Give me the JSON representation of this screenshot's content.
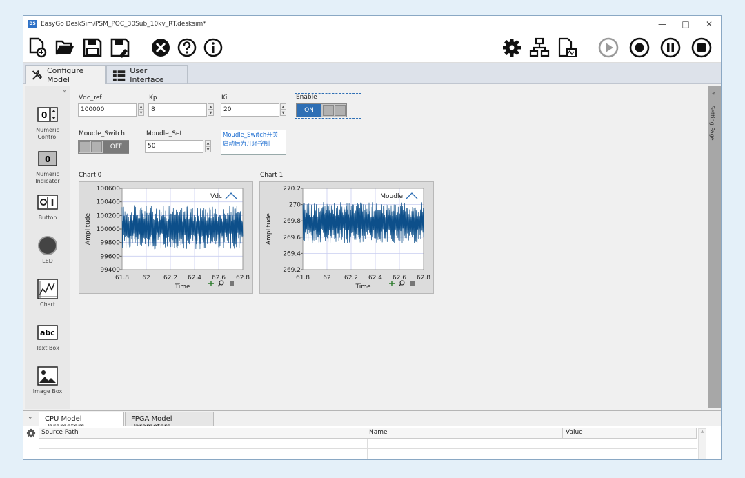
{
  "window": {
    "title": "EasyGo DeskSim/PSM_POC_30Sub_10kv_RT.desksim*",
    "app_icon": "DS"
  },
  "mode_tabs": [
    {
      "label": "Configure Model"
    },
    {
      "label": "User Interface"
    }
  ],
  "palette": [
    {
      "label_lines": [
        "Numeric",
        "Control"
      ],
      "icon": "numeric-control-icon",
      "glyph": "0"
    },
    {
      "label_lines": [
        "Numeric",
        "Indicator"
      ],
      "icon": "numeric-indicator-icon",
      "glyph": "0"
    },
    {
      "label_lines": [
        "Button",
        ""
      ],
      "icon": "button-icon",
      "glyph": "O|I"
    },
    {
      "label_lines": [
        "LED",
        ""
      ],
      "icon": "led-icon"
    },
    {
      "label_lines": [
        "Chart",
        ""
      ],
      "icon": "chart-icon"
    },
    {
      "label_lines": [
        "Text Box",
        ""
      ],
      "icon": "text-box-icon",
      "glyph": "abc"
    },
    {
      "label_lines": [
        "Image Box",
        ""
      ],
      "icon": "image-box-icon"
    }
  ],
  "controls": {
    "vdc_ref": {
      "label": "Vdc_ref",
      "value": "100000"
    },
    "kp": {
      "label": "Kp",
      "value": "8"
    },
    "ki": {
      "label": "Ki",
      "value": "20"
    },
    "enable": {
      "label": "Enable",
      "state": "ON"
    },
    "moudle_switch": {
      "label": "Moudle_Switch",
      "state": "OFF"
    },
    "moudle_set": {
      "label": "Moudle_Set",
      "value": "50"
    },
    "note": {
      "line1": "Moudle_Switch开关",
      "line2": "启动后为开环控制"
    }
  },
  "charts_ui": [
    {
      "title": "Chart 0",
      "legend": "Vdc",
      "ylabel": "Amplitude",
      "xlabel": "Time"
    },
    {
      "title": "Chart 1",
      "legend": "Moudle",
      "ylabel": "Amplitude",
      "xlabel": "Time"
    }
  ],
  "chart_data": [
    {
      "type": "line",
      "title": "Chart 0",
      "xlabel": "Time",
      "ylabel": "Amplitude",
      "series": [
        {
          "name": "Vdc",
          "color": "#0d4f8a"
        }
      ],
      "xlim": [
        61.8,
        62.8
      ],
      "ylim": [
        99400,
        100600
      ],
      "xticks": [
        "61.8",
        "62",
        "62.2",
        "62.4",
        "62.6",
        "62.8"
      ],
      "yticks": [
        "100600",
        "100400",
        "100200",
        "100000",
        "99800",
        "99600",
        "99400"
      ],
      "band": [
        99700,
        100350
      ],
      "grid": true,
      "legend": "top-right"
    },
    {
      "type": "line",
      "title": "Chart 1",
      "xlabel": "Time",
      "ylabel": "Amplitude",
      "series": [
        {
          "name": "Moudle",
          "color": "#0d4f8a"
        }
      ],
      "xlim": [
        61.8,
        62.8
      ],
      "ylim": [
        269.2,
        270.2
      ],
      "xticks": [
        "61.8",
        "62",
        "62.2",
        "62.4",
        "62.6",
        "62.8"
      ],
      "yticks": [
        "270.2",
        "270",
        "269.8",
        "269.6",
        "269.4",
        "269.2"
      ],
      "band": [
        269.52,
        270.03
      ],
      "grid": true,
      "legend": "top-right"
    }
  ],
  "setting_page": {
    "label": "Setting Page"
  },
  "bottom_tabs": [
    {
      "label": "CPU Model Parameters"
    },
    {
      "label": "FPGA Model Parameters"
    }
  ],
  "param_table": {
    "columns": [
      "Source Path",
      "Name",
      "Value"
    ]
  },
  "colors": {
    "accent": "#2e6fb5",
    "plot_line": "#0d4f8a"
  }
}
